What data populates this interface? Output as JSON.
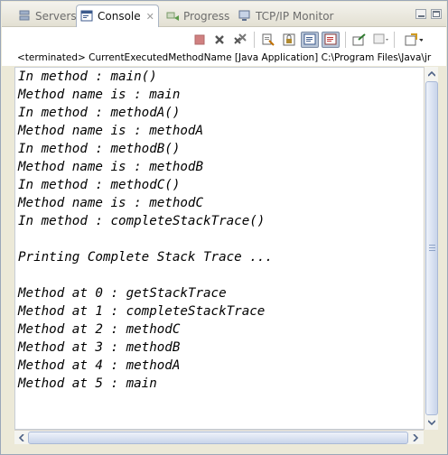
{
  "tabs": [
    {
      "label": "Servers",
      "icon": "servers-icon"
    },
    {
      "label": "Console",
      "icon": "console-icon",
      "close": "✕"
    },
    {
      "label": "Progress",
      "icon": "progress-icon"
    },
    {
      "label": "TCP/IP Monitor",
      "icon": "tcpip-monitor-icon"
    }
  ],
  "status_line": "<terminated> CurrentExecutedMethodName [Java Application] C:\\Program Files\\Java\\jr",
  "console_lines": [
    "In method : main()",
    "Method name is : main",
    "In method : methodA()",
    "Method name is : methodA",
    "In method : methodB()",
    "Method name is : methodB",
    "In method : methodC()",
    "Method name is : methodC",
    "In method : completeStackTrace()",
    "",
    "Printing Complete Stack Trace ...",
    "",
    "Method at 0 : getStackTrace",
    "Method at 1 : completeStackTrace",
    "Method at 2 : methodC",
    "Method at 3 : methodB",
    "Method at 4 : methodA",
    "Method at 5 : main"
  ],
  "colors": {
    "accent": "#b9c6d8",
    "scroll_thumb": "#c8d4ea",
    "terminate_disabled": "#d08080"
  }
}
